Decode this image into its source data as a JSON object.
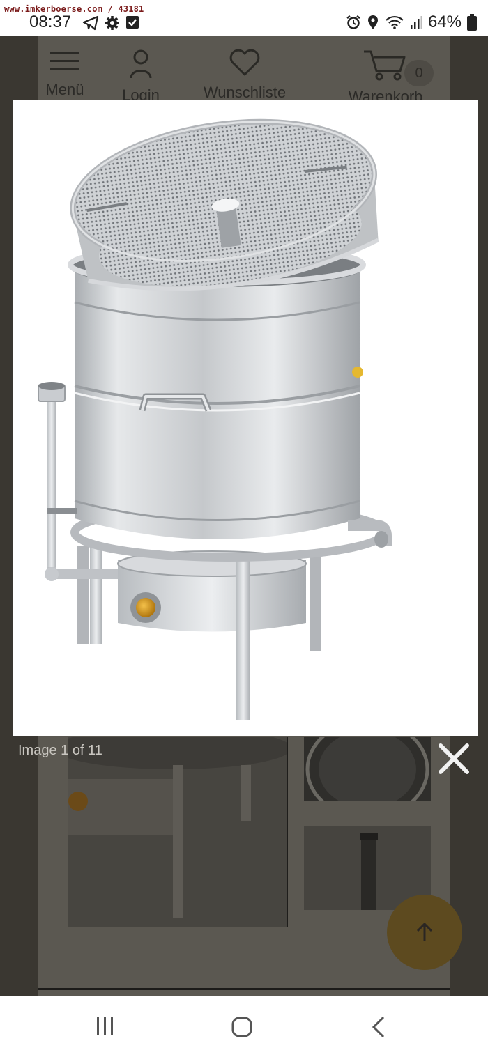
{
  "status_bar": {
    "watermark": "www.imkerboerse.com / 43181",
    "time": "08:37",
    "battery": "64%",
    "left_icons": [
      "telegram-icon",
      "settings-icon",
      "checkbox-icon"
    ],
    "right_icons": [
      "alarm-icon",
      "location-icon",
      "wifi-icon",
      "signal-icon",
      "battery-icon"
    ]
  },
  "site_nav": {
    "items": [
      {
        "label": "Menü",
        "icon": "hamburger-icon"
      },
      {
        "label": "Login",
        "icon": "user-icon"
      },
      {
        "label": "Wunschliste",
        "icon": "heart-icon"
      },
      {
        "label": "Warenkorb",
        "icon": "cart-icon"
      }
    ],
    "cart_count": "0"
  },
  "lightbox": {
    "caption": "Image 1 of 11",
    "close_icon": "close-icon",
    "image_alt": "Stainless steel wax melter with sieve basket"
  },
  "scroll_top_icon": "arrow-up-icon",
  "android_nav": [
    "recent-apps-icon",
    "home-icon",
    "back-icon"
  ],
  "colors": {
    "overlay": "#2b2a28",
    "accent": "#d99a1a",
    "steel": "#c9ccd0"
  }
}
